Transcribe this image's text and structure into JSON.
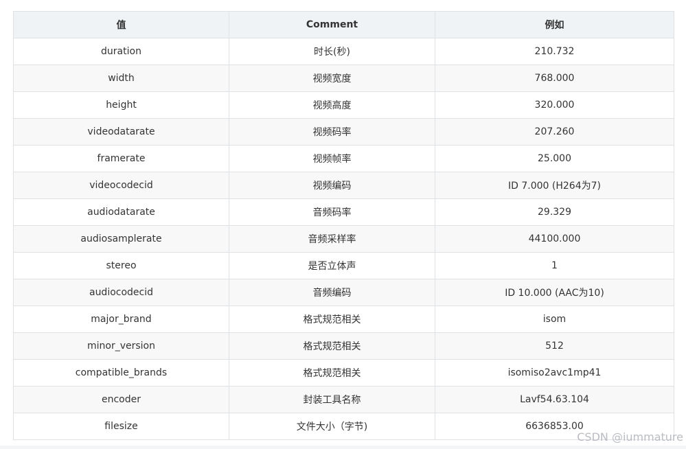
{
  "table": {
    "headers": [
      "值",
      "Comment",
      "例如"
    ],
    "rows": [
      [
        "duration",
        "时长(秒)",
        "210.732"
      ],
      [
        "width",
        "视频宽度",
        "768.000"
      ],
      [
        "height",
        "视频高度",
        "320.000"
      ],
      [
        "videodatarate",
        "视频码率",
        "207.260"
      ],
      [
        "framerate",
        "视频帧率",
        "25.000"
      ],
      [
        "videocodecid",
        "视频编码",
        "ID 7.000 (H264为7)"
      ],
      [
        "audiodatarate",
        "音频码率",
        "29.329"
      ],
      [
        "audiosamplerate",
        "音频采样率",
        "44100.000"
      ],
      [
        "stereo",
        "是否立体声",
        "1"
      ],
      [
        "audiocodecid",
        "音频编码",
        "ID 10.000 (AAC为10)"
      ],
      [
        "major_brand",
        "格式规范相关",
        "isom"
      ],
      [
        "minor_version",
        "格式规范相关",
        "512"
      ],
      [
        "compatible_brands",
        "格式规范相关",
        "isomiso2avc1mp41"
      ],
      [
        "encoder",
        "封装工具名称",
        "Lavf54.63.104"
      ],
      [
        "filesize",
        "文件大小（字节)",
        "6636853.00"
      ]
    ]
  },
  "watermark": "CSDN @iummature"
}
